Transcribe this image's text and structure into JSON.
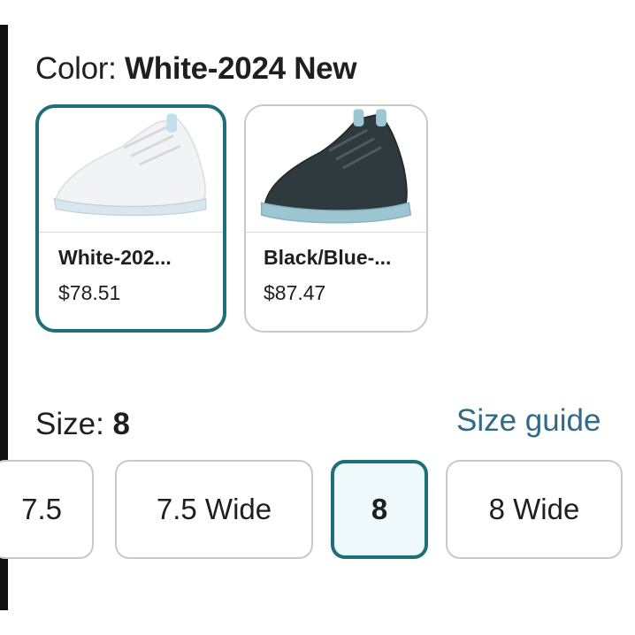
{
  "color": {
    "label": "Color:",
    "selected": "White-2024 New",
    "options": [
      {
        "name": "White-202...",
        "price": "$78.51",
        "selected": true
      },
      {
        "name": "Black/Blue-...",
        "price": "$87.47",
        "selected": false
      }
    ]
  },
  "size": {
    "label": "Size:",
    "selected": "8",
    "guide_label": "Size guide",
    "options": [
      {
        "label": "7.5",
        "selected": false
      },
      {
        "label": "7.5 Wide",
        "selected": false
      },
      {
        "label": "8",
        "selected": true
      },
      {
        "label": "8 Wide",
        "selected": false
      }
    ]
  },
  "colors": {
    "accent": "#1f6f78",
    "selected_bg": "#eefafc",
    "link": "#2f6a86",
    "border": "#c9c9c9"
  }
}
